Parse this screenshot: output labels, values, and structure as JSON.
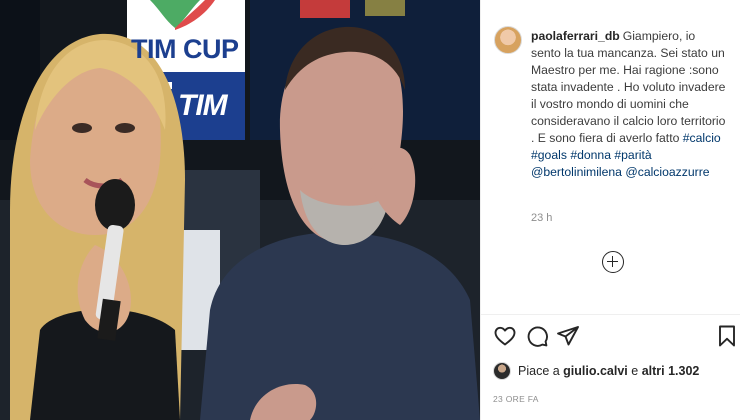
{
  "photo": {
    "alt_objects": [
      "tim-cup-logo",
      "presenter-woman",
      "microphone",
      "man-with-glasses"
    ],
    "tim_cup_text": "TIM CUP",
    "tim_brand_text": "TIM"
  },
  "post": {
    "username": "paolaferrari_db",
    "caption_segments": [
      {
        "type": "text",
        "text": "Giampiero, io sento la tua mancanza. Sei stato un Maestro per me. Hai ragione :sono stata invadente . Ho voluto invadere il vostro mondo di uomini che consideravano il calcio loro territorio . E sono fiera di averlo fatto "
      },
      {
        "type": "tag",
        "text": "#calcio"
      },
      {
        "type": "text",
        "text": " "
      },
      {
        "type": "tag",
        "text": "#goals"
      },
      {
        "type": "text",
        "text": " "
      },
      {
        "type": "tag",
        "text": "#donna"
      },
      {
        "type": "text",
        "text": " "
      },
      {
        "type": "tag",
        "text": "#parità"
      },
      {
        "type": "text",
        "text": " "
      },
      {
        "type": "tag",
        "text": "@bertolinimilena"
      },
      {
        "type": "text",
        "text": " "
      },
      {
        "type": "tag",
        "text": "@calcioazzurre"
      }
    ],
    "time_ago": "23 h",
    "likes_prefix": "Piace a ",
    "likes_user": "giulio.calvi",
    "likes_middle": " e ",
    "likes_count": "altri 1.302",
    "date_label": "23 ORE FA"
  },
  "icons": {
    "like": "heart-icon",
    "comment": "comment-icon",
    "share": "share-icon",
    "save": "bookmark-icon",
    "add_comment": "plus-circle-icon"
  },
  "colors": {
    "tag": "#00376b",
    "muted": "#8e8e8e",
    "text": "#262626"
  }
}
